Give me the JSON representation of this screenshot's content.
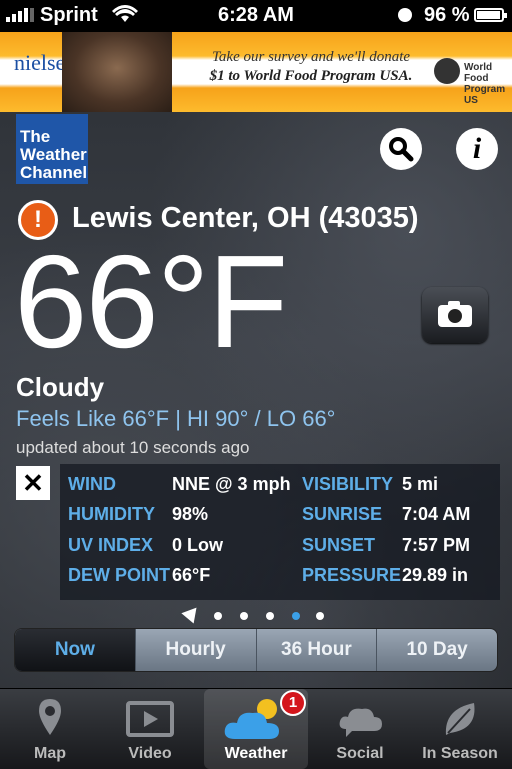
{
  "status_bar": {
    "carrier": "Sprint",
    "time": "6:28 AM",
    "battery_percent": "96 %",
    "battery_level": 0.96
  },
  "ad": {
    "brand": "nielsen",
    "line1": "Take our survey and we'll donate",
    "line2": "$1 to World Food Program USA.",
    "partner_line1": "World Food",
    "partner_line2": "Program US",
    "partner_logo_text": "WFP"
  },
  "header": {
    "logo_line1": "The",
    "logo_line2": "Weather",
    "logo_line3": "Channel",
    "search_icon": "search-icon",
    "info_label": "i"
  },
  "weather": {
    "alert_symbol": "!",
    "location": "Lewis Center, OH (43035)",
    "temperature": "66°F",
    "condition": "Cloudy",
    "feels_line": "Feels Like 66°F | HI 90° / LO 66°",
    "updated": "updated about 10 seconds ago"
  },
  "details": {
    "close_symbol": "✕",
    "rows": [
      {
        "l1": "WIND",
        "v1": "NNE @ 3 mph",
        "l2": "VISIBILITY",
        "v2": "5 mi"
      },
      {
        "l1": "HUMIDITY",
        "v1": "98%",
        "l2": "SUNRISE",
        "v2": "7:04 AM"
      },
      {
        "l1": "UV INDEX",
        "v1": "0 Low",
        "l2": "SUNSET",
        "v2": "7:57 PM"
      },
      {
        "l1": "DEW POINT",
        "v1": "66°F",
        "l2": "PRESSURE",
        "v2": "29.89 in"
      }
    ]
  },
  "pager": {
    "page_count": 5,
    "active_page": 4
  },
  "segments": [
    "Now",
    "Hourly",
    "36 Hour",
    "10 Day"
  ],
  "tabbar": {
    "items": [
      "Map",
      "Video",
      "Weather",
      "Social",
      "In Season"
    ],
    "selected": "Weather",
    "badge": "1"
  },
  "colors": {
    "accent_blue": "#5eaee8",
    "twc_blue": "#1f56a8",
    "alert_orange": "#e85d16",
    "badge_red": "#d4161c"
  }
}
